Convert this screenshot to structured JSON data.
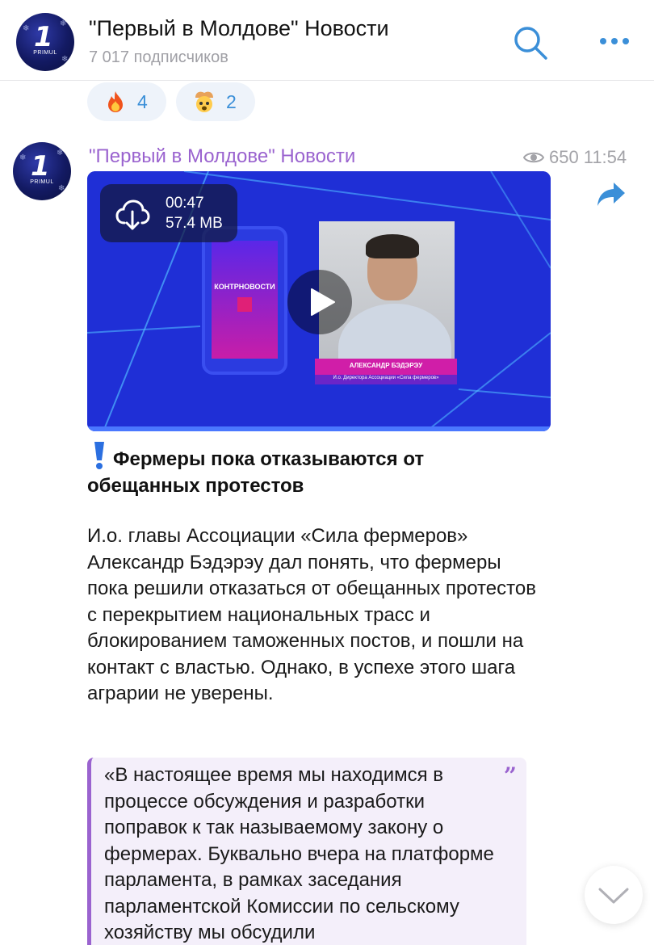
{
  "header": {
    "title": "\"Первый в Молдове\" Новости",
    "subscribers": "7 017 подписчиков",
    "avatar_text": "PRIMUL"
  },
  "reactions": [
    {
      "emoji": "fire-icon",
      "count": "4"
    },
    {
      "emoji": "exploding-head-icon",
      "count": "2"
    }
  ],
  "post": {
    "channel_name": "\"Первый в Молдове\" Новости",
    "views": "650",
    "time": "11:54",
    "video": {
      "duration": "00:47",
      "size": "57.4 MB",
      "phone_label": "КОНТРНОВОСТИ",
      "name_plate": "АЛЕКСАНДР БЭДЭРЭУ",
      "name_subtitle": "И.о. Директора Ассоциации «Сила фермеров»"
    },
    "headline": "Фермеры пока отказываются от обещанных протестов",
    "body": "И.о. главы Ассоциации «Сила фермеров» Александр Бэдэрэу дал понять, что фермеры пока решили отказаться от обещанных протестов с перекрытием национальных трасс и блокированием таможенных постов, и пошли на контакт с властью. Однако, в успехе этого шага аграрии не уверены.",
    "quote": "«В настоящее время мы находимся в процессе обсуждения и разработки поправок к так называемому закону о фермерах. Буквально вчера на платформе парламента, в рамках заседания парламентской Комиссии по сельскому хозяйству мы обсудили"
  },
  "colors": {
    "accent_blue": "#3b8fd8",
    "channel_purple": "#9a63cf",
    "reaction_bg": "#eef3fa",
    "quote_bg": "#f4effa",
    "video_blue": "#1f2fd6"
  }
}
